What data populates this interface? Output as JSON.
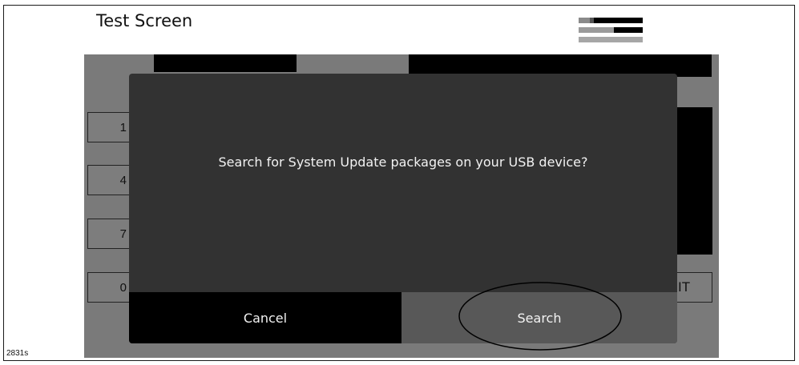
{
  "header": {
    "title": "Test Screen",
    "status_icon": "signal-icon"
  },
  "keypad": {
    "keys": [
      "1",
      "4",
      "7",
      "0"
    ],
    "edit_label_partial": "IT"
  },
  "dialog": {
    "message": "Search for System Update packages on your USB device?",
    "cancel_label": "Cancel",
    "search_label": "Search",
    "highlighted_button": "Search"
  },
  "figure": {
    "id": "2831s"
  },
  "colors": {
    "dialog_bg": "#323232",
    "cancel_bg": "#000000",
    "search_bg": "#585858",
    "screen_bg": "#7a7a7a"
  }
}
